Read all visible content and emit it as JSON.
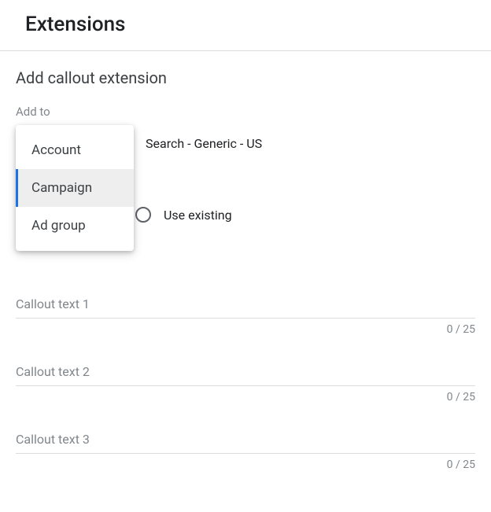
{
  "header": {
    "title": "Extensions"
  },
  "section": {
    "title": "Add callout extension"
  },
  "add_to": {
    "label": "Add to",
    "campaign_value": "Search - Generic - US",
    "options": [
      "Account",
      "Campaign",
      "Ad group"
    ],
    "selected_index": 1
  },
  "mode": {
    "option_label": "Use existing"
  },
  "callouts": [
    {
      "placeholder": "Callout text 1",
      "counter": "0 / 25"
    },
    {
      "placeholder": "Callout text 2",
      "counter": "0 / 25"
    },
    {
      "placeholder": "Callout text 3",
      "counter": "0 / 25"
    }
  ]
}
